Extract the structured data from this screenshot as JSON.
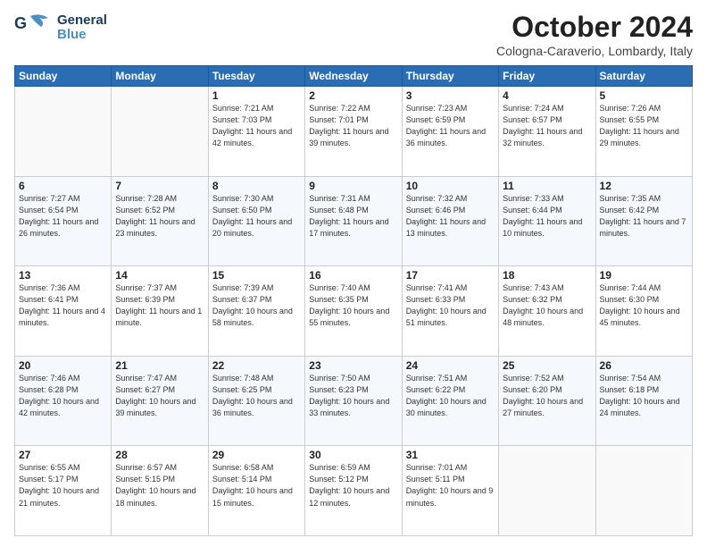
{
  "header": {
    "logo_general": "General",
    "logo_blue": "Blue",
    "month_title": "October 2024",
    "location": "Cologna-Caraverio, Lombardy, Italy"
  },
  "days_of_week": [
    "Sunday",
    "Monday",
    "Tuesday",
    "Wednesday",
    "Thursday",
    "Friday",
    "Saturday"
  ],
  "weeks": [
    [
      {
        "day": "",
        "sunrise": "",
        "sunset": "",
        "daylight": ""
      },
      {
        "day": "",
        "sunrise": "",
        "sunset": "",
        "daylight": ""
      },
      {
        "day": "1",
        "sunrise": "Sunrise: 7:21 AM",
        "sunset": "Sunset: 7:03 PM",
        "daylight": "Daylight: 11 hours and 42 minutes."
      },
      {
        "day": "2",
        "sunrise": "Sunrise: 7:22 AM",
        "sunset": "Sunset: 7:01 PM",
        "daylight": "Daylight: 11 hours and 39 minutes."
      },
      {
        "day": "3",
        "sunrise": "Sunrise: 7:23 AM",
        "sunset": "Sunset: 6:59 PM",
        "daylight": "Daylight: 11 hours and 36 minutes."
      },
      {
        "day": "4",
        "sunrise": "Sunrise: 7:24 AM",
        "sunset": "Sunset: 6:57 PM",
        "daylight": "Daylight: 11 hours and 32 minutes."
      },
      {
        "day": "5",
        "sunrise": "Sunrise: 7:26 AM",
        "sunset": "Sunset: 6:55 PM",
        "daylight": "Daylight: 11 hours and 29 minutes."
      }
    ],
    [
      {
        "day": "6",
        "sunrise": "Sunrise: 7:27 AM",
        "sunset": "Sunset: 6:54 PM",
        "daylight": "Daylight: 11 hours and 26 minutes."
      },
      {
        "day": "7",
        "sunrise": "Sunrise: 7:28 AM",
        "sunset": "Sunset: 6:52 PM",
        "daylight": "Daylight: 11 hours and 23 minutes."
      },
      {
        "day": "8",
        "sunrise": "Sunrise: 7:30 AM",
        "sunset": "Sunset: 6:50 PM",
        "daylight": "Daylight: 11 hours and 20 minutes."
      },
      {
        "day": "9",
        "sunrise": "Sunrise: 7:31 AM",
        "sunset": "Sunset: 6:48 PM",
        "daylight": "Daylight: 11 hours and 17 minutes."
      },
      {
        "day": "10",
        "sunrise": "Sunrise: 7:32 AM",
        "sunset": "Sunset: 6:46 PM",
        "daylight": "Daylight: 11 hours and 13 minutes."
      },
      {
        "day": "11",
        "sunrise": "Sunrise: 7:33 AM",
        "sunset": "Sunset: 6:44 PM",
        "daylight": "Daylight: 11 hours and 10 minutes."
      },
      {
        "day": "12",
        "sunrise": "Sunrise: 7:35 AM",
        "sunset": "Sunset: 6:42 PM",
        "daylight": "Daylight: 11 hours and 7 minutes."
      }
    ],
    [
      {
        "day": "13",
        "sunrise": "Sunrise: 7:36 AM",
        "sunset": "Sunset: 6:41 PM",
        "daylight": "Daylight: 11 hours and 4 minutes."
      },
      {
        "day": "14",
        "sunrise": "Sunrise: 7:37 AM",
        "sunset": "Sunset: 6:39 PM",
        "daylight": "Daylight: 11 hours and 1 minute."
      },
      {
        "day": "15",
        "sunrise": "Sunrise: 7:39 AM",
        "sunset": "Sunset: 6:37 PM",
        "daylight": "Daylight: 10 hours and 58 minutes."
      },
      {
        "day": "16",
        "sunrise": "Sunrise: 7:40 AM",
        "sunset": "Sunset: 6:35 PM",
        "daylight": "Daylight: 10 hours and 55 minutes."
      },
      {
        "day": "17",
        "sunrise": "Sunrise: 7:41 AM",
        "sunset": "Sunset: 6:33 PM",
        "daylight": "Daylight: 10 hours and 51 minutes."
      },
      {
        "day": "18",
        "sunrise": "Sunrise: 7:43 AM",
        "sunset": "Sunset: 6:32 PM",
        "daylight": "Daylight: 10 hours and 48 minutes."
      },
      {
        "day": "19",
        "sunrise": "Sunrise: 7:44 AM",
        "sunset": "Sunset: 6:30 PM",
        "daylight": "Daylight: 10 hours and 45 minutes."
      }
    ],
    [
      {
        "day": "20",
        "sunrise": "Sunrise: 7:46 AM",
        "sunset": "Sunset: 6:28 PM",
        "daylight": "Daylight: 10 hours and 42 minutes."
      },
      {
        "day": "21",
        "sunrise": "Sunrise: 7:47 AM",
        "sunset": "Sunset: 6:27 PM",
        "daylight": "Daylight: 10 hours and 39 minutes."
      },
      {
        "day": "22",
        "sunrise": "Sunrise: 7:48 AM",
        "sunset": "Sunset: 6:25 PM",
        "daylight": "Daylight: 10 hours and 36 minutes."
      },
      {
        "day": "23",
        "sunrise": "Sunrise: 7:50 AM",
        "sunset": "Sunset: 6:23 PM",
        "daylight": "Daylight: 10 hours and 33 minutes."
      },
      {
        "day": "24",
        "sunrise": "Sunrise: 7:51 AM",
        "sunset": "Sunset: 6:22 PM",
        "daylight": "Daylight: 10 hours and 30 minutes."
      },
      {
        "day": "25",
        "sunrise": "Sunrise: 7:52 AM",
        "sunset": "Sunset: 6:20 PM",
        "daylight": "Daylight: 10 hours and 27 minutes."
      },
      {
        "day": "26",
        "sunrise": "Sunrise: 7:54 AM",
        "sunset": "Sunset: 6:18 PM",
        "daylight": "Daylight: 10 hours and 24 minutes."
      }
    ],
    [
      {
        "day": "27",
        "sunrise": "Sunrise: 6:55 AM",
        "sunset": "Sunset: 5:17 PM",
        "daylight": "Daylight: 10 hours and 21 minutes."
      },
      {
        "day": "28",
        "sunrise": "Sunrise: 6:57 AM",
        "sunset": "Sunset: 5:15 PM",
        "daylight": "Daylight: 10 hours and 18 minutes."
      },
      {
        "day": "29",
        "sunrise": "Sunrise: 6:58 AM",
        "sunset": "Sunset: 5:14 PM",
        "daylight": "Daylight: 10 hours and 15 minutes."
      },
      {
        "day": "30",
        "sunrise": "Sunrise: 6:59 AM",
        "sunset": "Sunset: 5:12 PM",
        "daylight": "Daylight: 10 hours and 12 minutes."
      },
      {
        "day": "31",
        "sunrise": "Sunrise: 7:01 AM",
        "sunset": "Sunset: 5:11 PM",
        "daylight": "Daylight: 10 hours and 9 minutes."
      },
      {
        "day": "",
        "sunrise": "",
        "sunset": "",
        "daylight": ""
      },
      {
        "day": "",
        "sunrise": "",
        "sunset": "",
        "daylight": ""
      }
    ]
  ]
}
